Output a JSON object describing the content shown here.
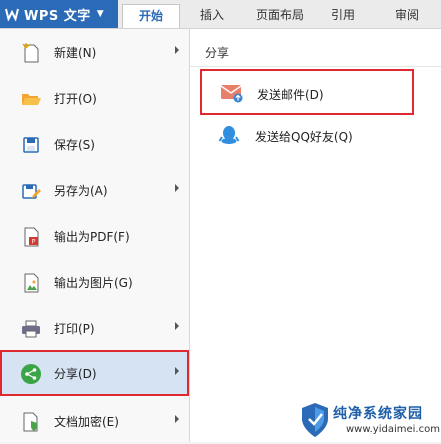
{
  "app": {
    "title": "WPS 文字",
    "logo_icon": "wps-logo-icon",
    "dropdown_icon": "caret-down-icon",
    "accent": "#2a6ab6"
  },
  "tabs": [
    {
      "label": "开始",
      "active": true
    },
    {
      "label": "插入"
    },
    {
      "label": "页面布局"
    },
    {
      "label": "引用"
    },
    {
      "label": "审阅"
    }
  ],
  "menu": {
    "items": [
      {
        "label": "新建(N)",
        "icon": "new-document-icon",
        "has_submenu": true
      },
      {
        "label": "打开(O)",
        "icon": "open-folder-icon",
        "has_submenu": false
      },
      {
        "label": "保存(S)",
        "icon": "save-disk-icon",
        "has_submenu": false
      },
      {
        "label": "另存为(A)",
        "icon": "save-as-icon",
        "has_submenu": true
      },
      {
        "label": "输出为PDF(F)",
        "icon": "pdf-export-icon",
        "has_submenu": false
      },
      {
        "label": "输出为图片(G)",
        "icon": "image-export-icon",
        "has_submenu": false
      },
      {
        "label": "打印(P)",
        "icon": "printer-icon",
        "has_submenu": true
      },
      {
        "label": "分享(D)",
        "icon": "share-icon",
        "has_submenu": true,
        "active": true
      },
      {
        "label": "文档加密(E)",
        "icon": "encrypt-document-icon",
        "has_submenu": true
      }
    ]
  },
  "share_panel": {
    "title": "分享",
    "items": [
      {
        "label": "发送邮件(D)",
        "icon": "mail-send-icon",
        "highlighted": true
      },
      {
        "label": "发送给QQ好友(Q)",
        "icon": "qq-icon"
      }
    ]
  },
  "watermark": {
    "title": "纯净系统家园",
    "url": "www.yidaimei.com"
  },
  "colors": {
    "highlight_border": "#e0292e",
    "active_item_bg": "#d5e3f3"
  }
}
